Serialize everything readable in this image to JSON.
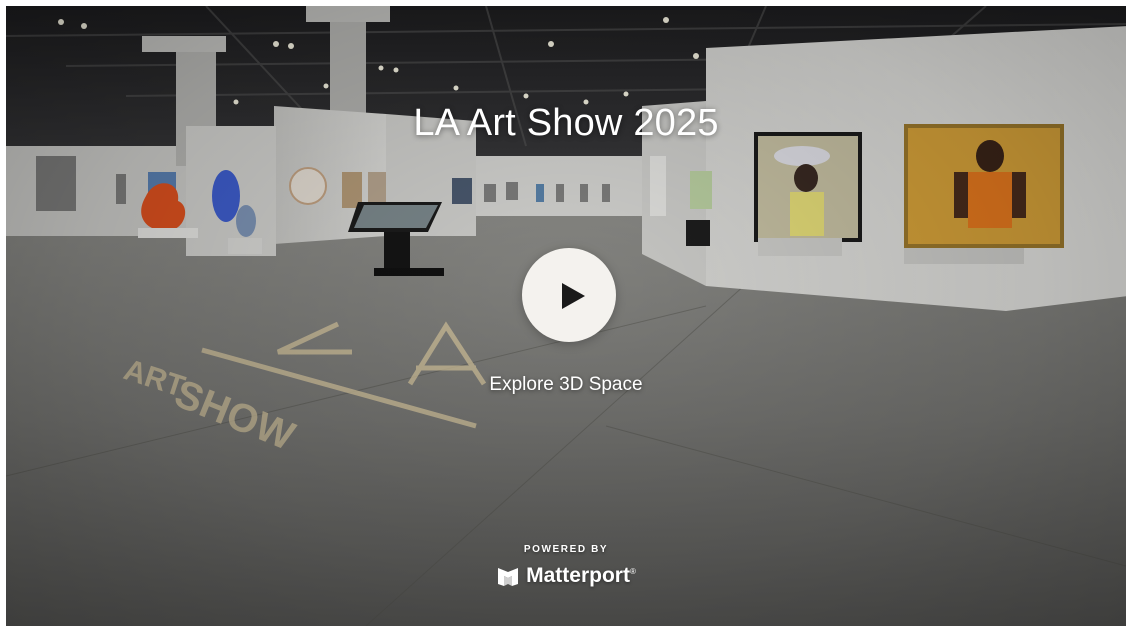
{
  "tour": {
    "title": "LA Art Show 2025",
    "cta_label": "Explore 3D Space"
  },
  "branding": {
    "powered_by": "POWERED BY",
    "name": "Matterport",
    "reg_mark": "®",
    "logo_icon": "matterport-logo-icon"
  },
  "icons": {
    "play": "play-icon"
  },
  "colors": {
    "play_button_bg": "#f4f2ee",
    "play_glyph": "#1a1a1a",
    "text": "#ffffff"
  }
}
